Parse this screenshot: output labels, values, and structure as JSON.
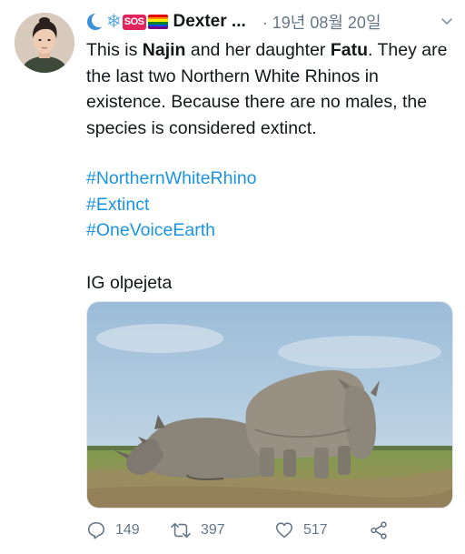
{
  "tweet": {
    "author_name": "Dexter ...",
    "date": "· 19년 08월 20일",
    "text": {
      "s1_a": "This is ",
      "s1_b": "Najin",
      "s1_c": " and her daughter ",
      "s1_d": "Fatu",
      "s1_e": ". They are the last two Northern White Rhinos in existence. Because there are no males, the species is considered extinct."
    },
    "hashtags": [
      "#NorthernWhiteRhino",
      "#Extinct",
      "#OneVoiceEarth"
    ],
    "credit": "IG olpejeta",
    "badges": {
      "sos": "SOS"
    }
  },
  "actions": {
    "reply_count": "149",
    "retweet_count": "397",
    "like_count": "517"
  },
  "colors": {
    "link": "#1b95e0",
    "muted": "#657786",
    "text": "#14171a"
  },
  "icons": [
    "avatar",
    "crescent-moon-icon",
    "snowflake-icon",
    "sos-icon",
    "rainbow-flag-icon",
    "chevron-down-icon",
    "reply-icon",
    "retweet-icon",
    "like-icon",
    "share-icon"
  ]
}
